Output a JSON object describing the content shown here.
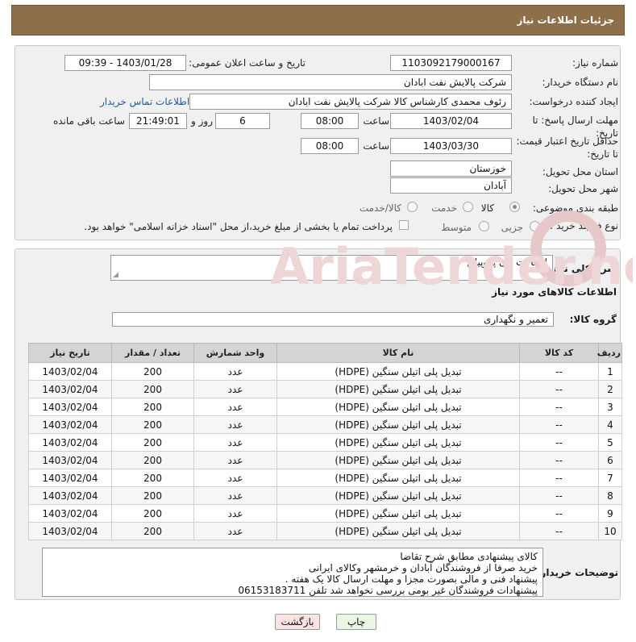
{
  "header": {
    "title": "جزئیات اطلاعات نیاز"
  },
  "labels": {
    "need_number": "شماره نیاز:",
    "announce_datetime": "تاریخ و ساعت اعلان عمومی:",
    "buyer_org": "نام دستگاه خریدار:",
    "requester": "ایجاد کننده درخواست:",
    "reply_deadline": "مهلت ارسال پاسخ: تا تاریخ:",
    "price_validity": "حداقل تاریخ اعتبار قیمت: تا تاریخ:",
    "time": "ساعت",
    "days_and": "روز و",
    "remaining": "ساعت باقی مانده",
    "province": "استان محل تحویل:",
    "city": "شهر محل تحویل:",
    "category": "طبقه بندی موضوعی:",
    "purchase_type": "نوع فرآیند خرید :",
    "need_description": "شرح کلی نیاز:",
    "goods_info": "اطلاعات کالاهای مورد نیاز",
    "goods_group": "گروه کالا:",
    "buyer_notes": "توضیحات خریدار:"
  },
  "values": {
    "need_number": "1103092179000167",
    "announce_datetime": "1403/01/28 - 09:39",
    "buyer_org": "شرکت پالایش نفت ابادان",
    "requester": "رئوف محمدی کارشناس کالا شرکت پالایش نفت ابادان",
    "contact_link": "اطلاعات تماس خریدار",
    "reply_date": "1403/02/04",
    "reply_time": "08:00",
    "days": "6",
    "countdown": "21:49:01",
    "validity_date": "1403/03/30",
    "validity_time": "08:00",
    "province": "خوزستان",
    "city": "آبادان",
    "need_description": "اتصالات پلی پروپیلن",
    "goods_group": "تعمیر و نگهداری"
  },
  "category_options": [
    "کالا",
    "خدمت",
    "کالا/خدمت"
  ],
  "category_selected": "کالا",
  "purchase_options": [
    "جزیی",
    "متوسط"
  ],
  "payment_note": "پرداخت تمام یا بخشی از مبلغ خرید،از محل \"اسناد خزانه اسلامی\" خواهد بود.",
  "table": {
    "headers": [
      "ردیف",
      "کد کالا",
      "نام کالا",
      "واحد شمارش",
      "تعداد / مقدار",
      "تاریخ نیاز"
    ],
    "rows": [
      [
        "1",
        "--",
        "تبدیل پلی اتیلن سنگین (HDPE)",
        "عدد",
        "200",
        "1403/02/04"
      ],
      [
        "2",
        "--",
        "تبدیل پلی اتیلن سنگین (HDPE)",
        "عدد",
        "200",
        "1403/02/04"
      ],
      [
        "3",
        "--",
        "تبدیل پلی اتیلن سنگین (HDPE)",
        "عدد",
        "200",
        "1403/02/04"
      ],
      [
        "4",
        "--",
        "تبدیل پلی اتیلن سنگین (HDPE)",
        "عدد",
        "200",
        "1403/02/04"
      ],
      [
        "5",
        "--",
        "تبدیل پلی اتیلن سنگین (HDPE)",
        "عدد",
        "200",
        "1403/02/04"
      ],
      [
        "6",
        "--",
        "تبدیل پلی اتیلن سنگین (HDPE)",
        "عدد",
        "200",
        "1403/02/04"
      ],
      [
        "7",
        "--",
        "تبدیل پلی اتیلن سنگین (HDPE)",
        "عدد",
        "200",
        "1403/02/04"
      ],
      [
        "8",
        "--",
        "تبدیل پلی اتیلن سنگین (HDPE)",
        "عدد",
        "200",
        "1403/02/04"
      ],
      [
        "9",
        "--",
        "تبدیل پلی اتیلن سنگین (HDPE)",
        "عدد",
        "200",
        "1403/02/04"
      ],
      [
        "10",
        "--",
        "تبدیل پلی اتیلن سنگین (HDPE)",
        "عدد",
        "200",
        "1403/02/04"
      ]
    ]
  },
  "buyer_notes_lines": [
    "کالای پیشنهادی مطابق شرح تقاضا",
    "خرید صرفا از فروشندگان  آبادان و خرمشهر وکالای ایرانی",
    "پیشنهاد فنی و مالی بصورت مجزا و مهلت ارسال کالا یک هفته .",
    "پیشنهادات فروشندگان غیر بومی بررسی نخواهد شد تلفن 06153183711"
  ],
  "buttons": {
    "print": "چاپ",
    "back": "بازگشت"
  },
  "watermark_text": "AriaTender.net",
  "colors": {
    "header_bg": "#8d6f49",
    "link": "#1f5aa8",
    "print_bg": "#e9f6e3",
    "back_bg": "#f9e3e3"
  }
}
